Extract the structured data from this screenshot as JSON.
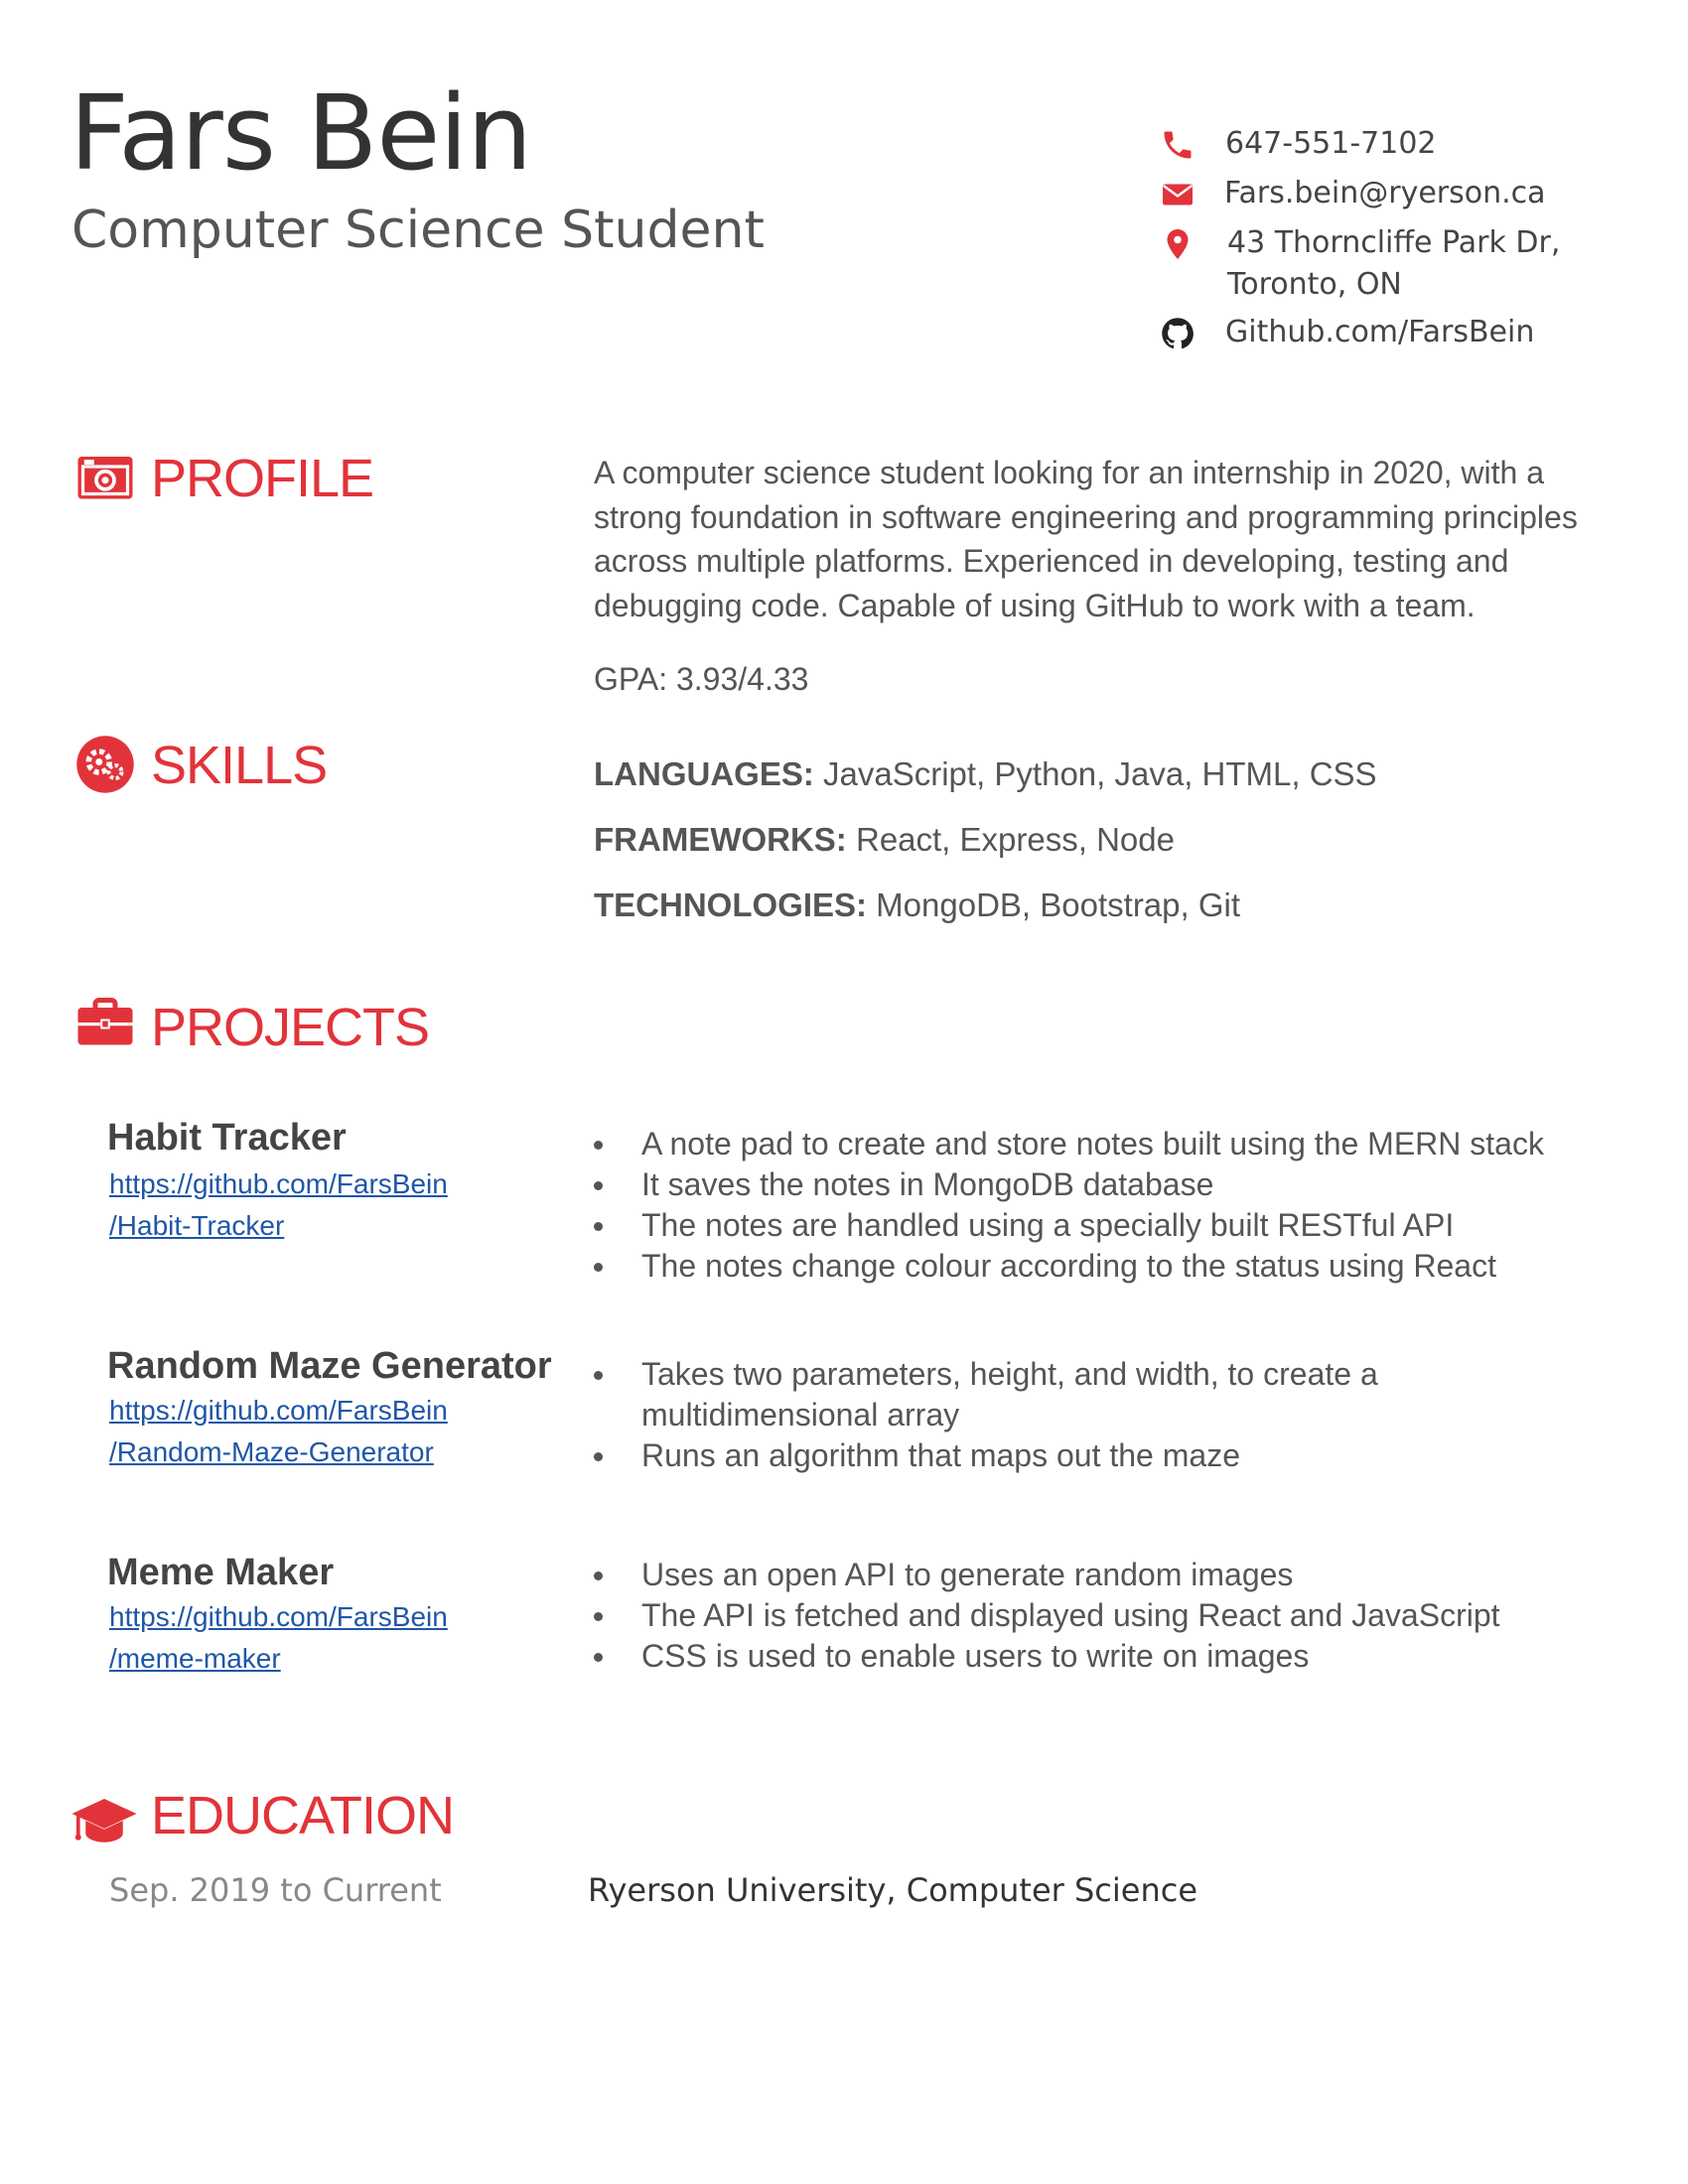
{
  "header": {
    "name": "Fars Bein",
    "subtitle": "Computer Science Student"
  },
  "contact": {
    "phone": "647-551-7102",
    "email": "Fars.bein@ryerson.ca",
    "address_line1": "43 Thorncliffe Park Dr,",
    "address_line2": "Toronto, ON",
    "github": "Github.com/FarsBein",
    "icons": [
      "phone-icon",
      "envelope-icon",
      "map-pin-icon",
      "github-icon"
    ]
  },
  "profile": {
    "heading": "PROFILE",
    "text": "A computer science student looking for an internship in 2020, with a strong foundation in software engineering and programming principles across multiple platforms. Experienced in developing, testing and debugging code. Capable of using GitHub to work with a team.",
    "gpa": "GPA: 3.93/4.33"
  },
  "skills": {
    "heading": "SKILLS",
    "items": [
      {
        "label": "LANGUAGES:",
        "value": " JavaScript, Python, Java, HTML, CSS"
      },
      {
        "label": "FRAMEWORKS:",
        "value": " React, Express, Node"
      },
      {
        "label": "TECHNOLOGIES:",
        "value": " MongoDB, Bootstrap, Git"
      }
    ]
  },
  "projects": {
    "heading": "PROJECTS",
    "items": [
      {
        "title": "Habit Tracker",
        "link_line1": "https://github.com/FarsBein",
        "link_line2": "/Habit-Tracker",
        "bullets": [
          "A note pad to create and store notes built using the MERN stack",
          "It saves the notes in MongoDB database",
          "The notes are handled using a specially built RESTful API",
          "The notes change colour according to the status using React"
        ]
      },
      {
        "title": "Random Maze Generator",
        "link_line1": "https://github.com/FarsBein",
        "link_line2": "/Random-Maze-Generator",
        "bullets": [
          "Takes two parameters, height, and width, to create a multidimensional array",
          "Runs an algorithm that maps out the maze"
        ]
      },
      {
        "title": "Meme Maker",
        "link_line1": "https://github.com/FarsBein",
        "link_line2": "/meme-maker",
        "bullets": [
          "Uses an open API to generate random images",
          "The API is fetched and displayed using React and JavaScript",
          "CSS is used to enable users to write on images"
        ]
      }
    ]
  },
  "education": {
    "heading": "EDUCATION",
    "date": "Sep. 2019 to Current",
    "school": "Ryerson University, Computer Science"
  },
  "colors": {
    "accent": "#e2333a",
    "text": "#444444",
    "link": "#1f56a8"
  }
}
